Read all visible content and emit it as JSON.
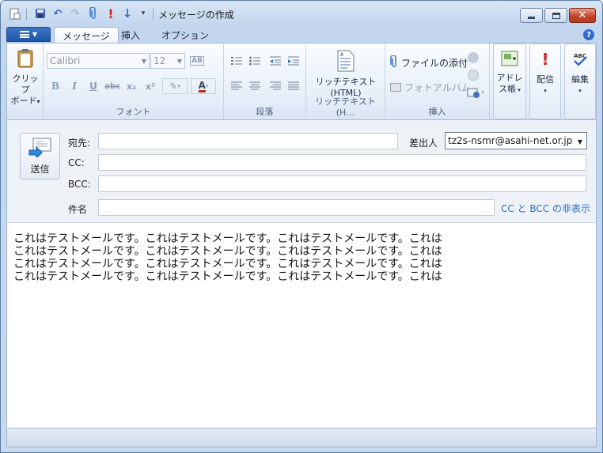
{
  "window": {
    "title": "メッセージの作成",
    "controls": {
      "minimize_icon": "minimize-icon",
      "maximize_icon": "maximize-icon",
      "close_icon": "close-icon"
    }
  },
  "quick_access": [
    "new-item-icon",
    "save-icon",
    "undo-icon",
    "redo-icon",
    "attach-icon",
    "high-priority-icon",
    "low-priority-icon",
    "customize-arrow-icon"
  ],
  "tabs": [
    {
      "label": "メッセージ",
      "active": true
    },
    {
      "label": "挿入",
      "active": false
    },
    {
      "label": "オプション",
      "active": false
    }
  ],
  "ribbon": {
    "clipboard": {
      "label_line1": "クリップ",
      "label_line2": "ボード"
    },
    "font": {
      "group_label": "フォント",
      "font_name": "Calibri",
      "font_size": "12",
      "bold": "B",
      "italic": "I",
      "underline": "U",
      "strike": "abc",
      "subscript": "x₂",
      "superscript": "x²",
      "color": "A"
    },
    "paragraph": {
      "group_label": "段落"
    },
    "richtext": {
      "button_line1": "リッチテキスト",
      "button_line2": "(HTML)",
      "group_label": "リッチテキスト(H…"
    },
    "insert": {
      "attach_label": "ファイルの添付",
      "photo_label": "フォトアルバム",
      "group_label": "挿入"
    },
    "address_book": {
      "line1": "アドレ",
      "line2": "ス帳"
    },
    "delivery": {
      "label": "配信"
    },
    "editing": {
      "label": "編集"
    }
  },
  "colors": {
    "accent": "#1d56a8",
    "link": "#2a6fc9",
    "priority": "#d32020"
  },
  "compose": {
    "send_label": "送信",
    "to_label": "宛先:",
    "from_label": "差出人",
    "from_value": "tz2s-nsmr@asahi-net.or.jp",
    "cc_label": "CC:",
    "bcc_label": "BCC:",
    "subject_label": "件名",
    "cc_bcc_link": "CC と BCC の非表示",
    "to_value": "",
    "cc_value": "",
    "bcc_value": "",
    "subject_value": ""
  },
  "body_lines": [
    "これはテストメールです。これはテストメールです。これはテストメールです。これは",
    "これはテストメールです。これはテストメールです。これはテストメールです。これは",
    "これはテストメールです。これはテストメールです。これはテストメールです。これは",
    "これはテストメールです。これはテストメールです。これはテストメールです。これは"
  ]
}
